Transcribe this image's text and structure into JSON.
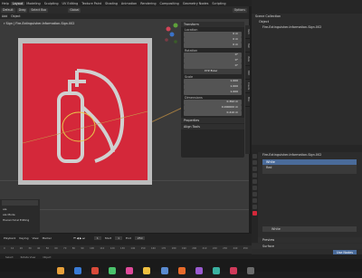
{
  "topbar": {
    "menus": [
      "Help"
    ],
    "workspaces": [
      "Layout",
      "Modeling",
      "Sculpting",
      "UV Editing",
      "Texture Paint",
      "Shading",
      "Animation",
      "Rendering",
      "Compositing",
      "Geometry Nodes",
      "Scripting"
    ],
    "active_workspace": "Layout",
    "scene": "Scene"
  },
  "toolbar": {
    "mode": "Default",
    "drag": "Drag",
    "select": "Select Box",
    "orientation": "Global",
    "options": "Options"
  },
  "menubar": [
    "Add",
    "Object"
  ],
  "viewport": {
    "header_text": "r Sign | Fire-Extinguisher-Information-Sign.002",
    "accent": "#d4283a"
  },
  "npanel": {
    "transform_title": "Transform",
    "location_label": "Location",
    "location": [
      "0 m",
      "0 m",
      "0 m"
    ],
    "rotation_label": "Rotation",
    "rotation": [
      "0°",
      "0°",
      "0°"
    ],
    "rotation_mode": "XYZ Euler",
    "scale_label": "Scale",
    "scale": [
      "1.000",
      "1.000",
      "1.000"
    ],
    "dimensions_label": "Dimensions",
    "dimensions": [
      "0.392 m",
      "0.000000 m",
      "0.410 m"
    ],
    "properties_label": "Properties",
    "align_tools_label": "Align Tools",
    "tabs": [
      "Item",
      "Tool",
      "View",
      "Edit",
      "Create",
      "Misc"
    ]
  },
  "outliner": {
    "title": "Scene Collection",
    "collection": "Object",
    "item": "Fire-Extinguisher-Information-Sign.002"
  },
  "properties": {
    "object_name": "Fire-Extinguisher-Information-Sign.002",
    "materials": [
      "White",
      "Red"
    ],
    "active_material": "White",
    "section_preview": "Preview",
    "section_surface": "Surface",
    "surface_value": "Use Nodes"
  },
  "leftpop": {
    "label": "ale",
    "extra": "ale Mode",
    "extra2": "Hierarchical Editing"
  },
  "timeline": {
    "playback": "Playback",
    "keying": "Keying",
    "view": "View",
    "marker": "Marker",
    "current_frame": "1",
    "start_label": "Start",
    "start": "1",
    "end_label": "End",
    "end": "250",
    "ticks": [
      "0",
      "10",
      "20",
      "30",
      "40",
      "50",
      "60",
      "70",
      "80",
      "90",
      "100",
      "110",
      "120",
      "130",
      "140",
      "150",
      "160",
      "170",
      "180",
      "190",
      "200",
      "210",
      "220",
      "230",
      "240",
      "250"
    ]
  },
  "statusbar": {
    "left": "Select",
    "mid": "Rotate View",
    "right": "Object"
  }
}
